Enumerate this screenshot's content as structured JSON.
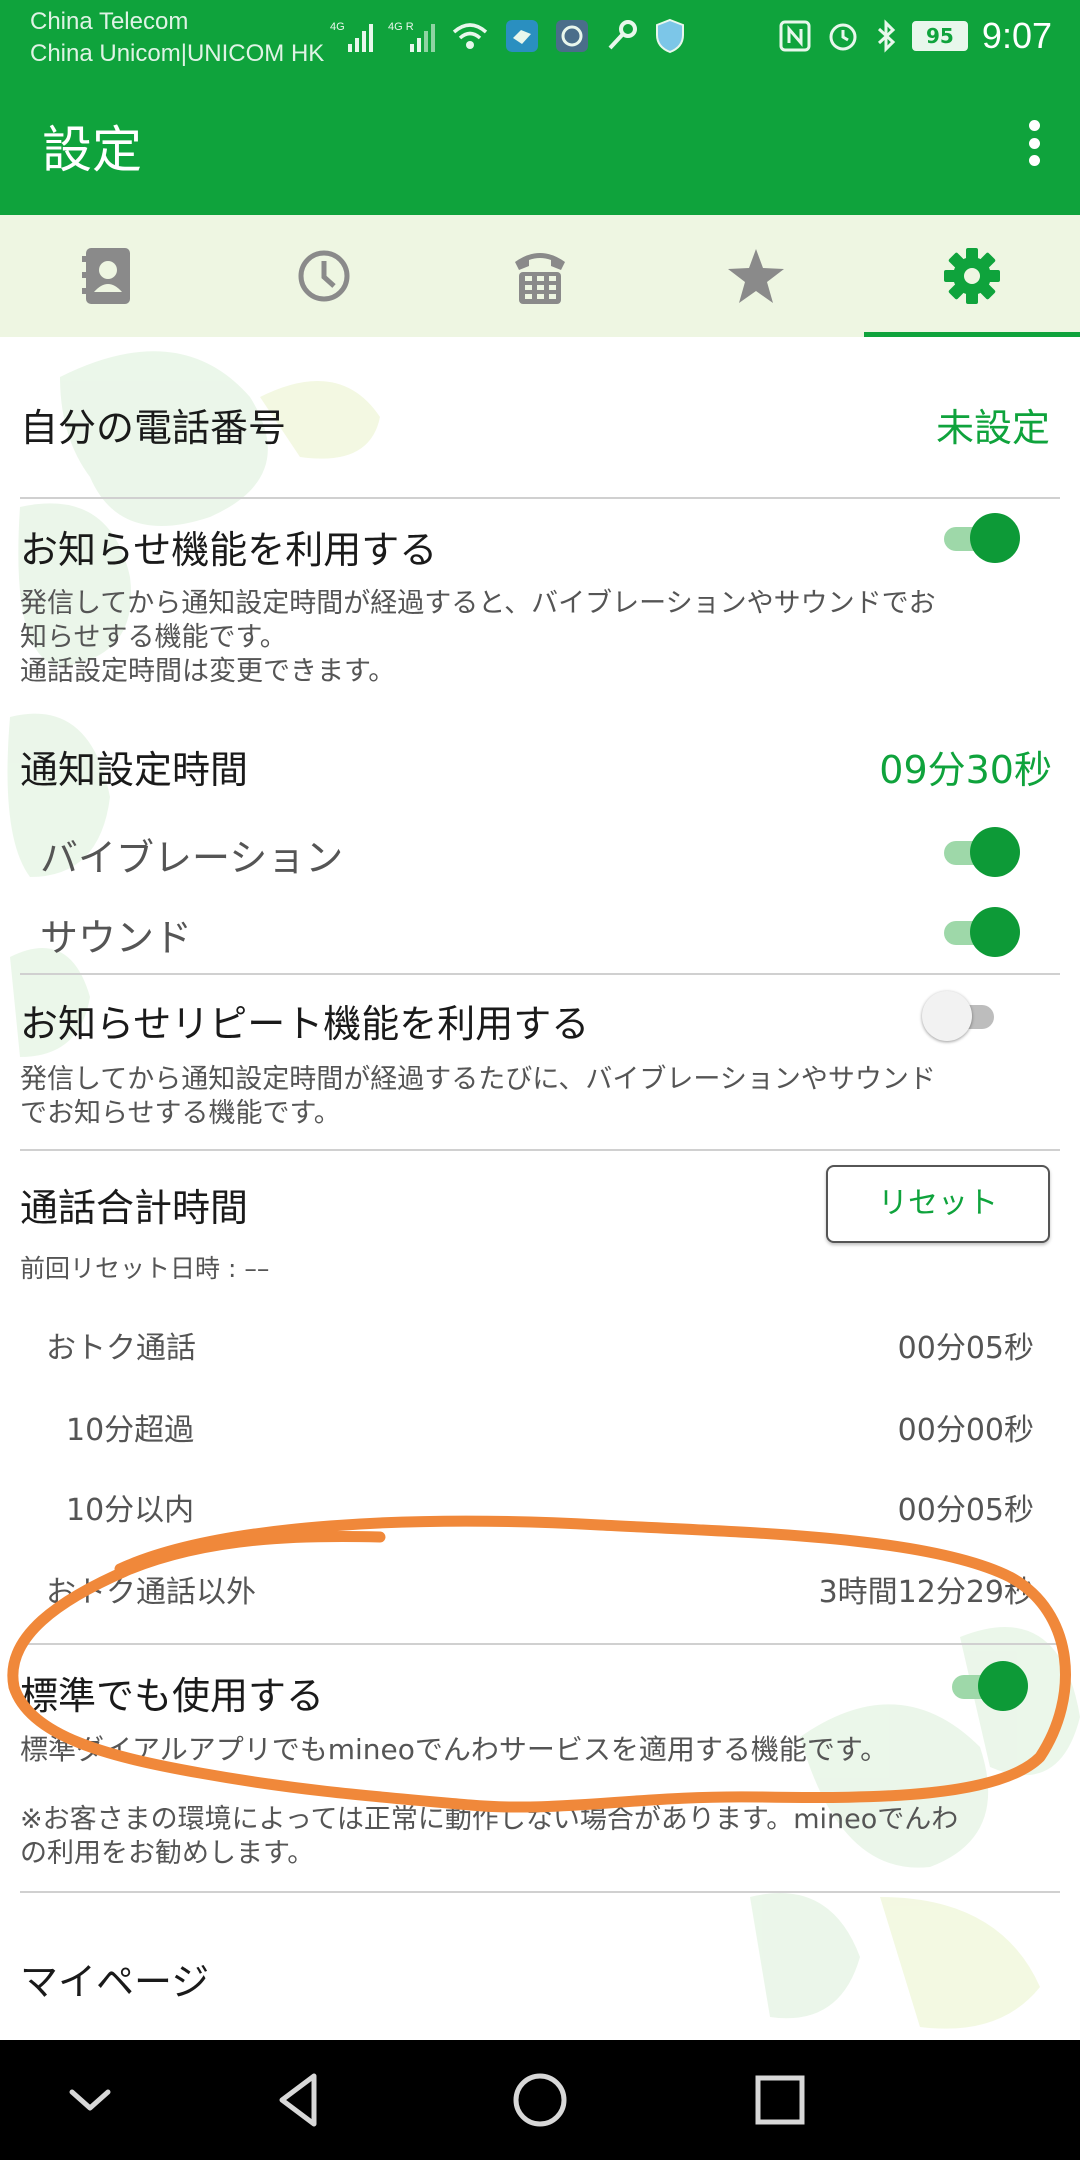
{
  "status_bar": {
    "carrier_1": "China Telecom",
    "carrier_2": "China Unicom|UNICOM HK",
    "time": "9:07",
    "battery": "95"
  },
  "app_bar": {
    "title": "設定",
    "menu_icon": "more-vert-icon"
  },
  "tabs": [
    {
      "icon": "contacts-icon",
      "active": false
    },
    {
      "icon": "history-clock-icon",
      "active": false
    },
    {
      "icon": "dialpad-phone-icon",
      "active": false
    },
    {
      "icon": "favorites-star-icon",
      "active": false
    },
    {
      "icon": "settings-gear-icon",
      "active": true
    }
  ],
  "settings": {
    "my_number": {
      "label": "自分の電話番号",
      "value": "未設定"
    },
    "notify": {
      "label": "お知らせ機能を利用する",
      "enabled": true,
      "desc_1": "発信してから通知設定時間が経過すると、バイブレーションやサウンドでお",
      "desc_2": "知らせする機能です。",
      "desc_3": "通話設定時間は変更できます。"
    },
    "notify_time": {
      "label": "通知設定時間",
      "value": "09分30秒"
    },
    "vibration": {
      "label": "バイブレーション",
      "enabled": true
    },
    "sound": {
      "label": "サウンド",
      "enabled": true
    },
    "repeat": {
      "label": "お知らせリピート機能を利用する",
      "enabled": false,
      "desc_1": "発信してから通知設定時間が経過するたびに、バイブレーションやサウンド",
      "desc_2": "でお知らせする機能です。"
    },
    "total_time": {
      "label": "通話合計時間",
      "reset_button": "リセット",
      "last_reset": "前回リセット日時 : ––",
      "rows": [
        {
          "label": "おトク通話",
          "value": "00分05秒"
        },
        {
          "label": "10分超過",
          "value": "00分00秒"
        },
        {
          "label": "10分以内",
          "value": "00分05秒"
        },
        {
          "label": "おトク通話以外",
          "value": "3時間12分29秒"
        }
      ]
    },
    "standard": {
      "label": "標準でも使用する",
      "enabled": true,
      "desc": "標準ダイアルアプリでもmineoでんわサービスを適用する機能です。",
      "note_1": "※お客さまの環境によっては正常に動作しない場合があります。mineoでんわ",
      "note_2": "の利用をお勧めします。"
    },
    "my_page": {
      "label": "マイページ"
    }
  },
  "nav_bar": {
    "buttons": [
      "chevron-down-icon",
      "back-triangle-icon",
      "home-circle-icon",
      "recents-square-icon"
    ]
  },
  "colors": {
    "brand_green": "#0fa33c",
    "tab_background": "#eef6e2",
    "annotation_orange": "#f0883a"
  }
}
